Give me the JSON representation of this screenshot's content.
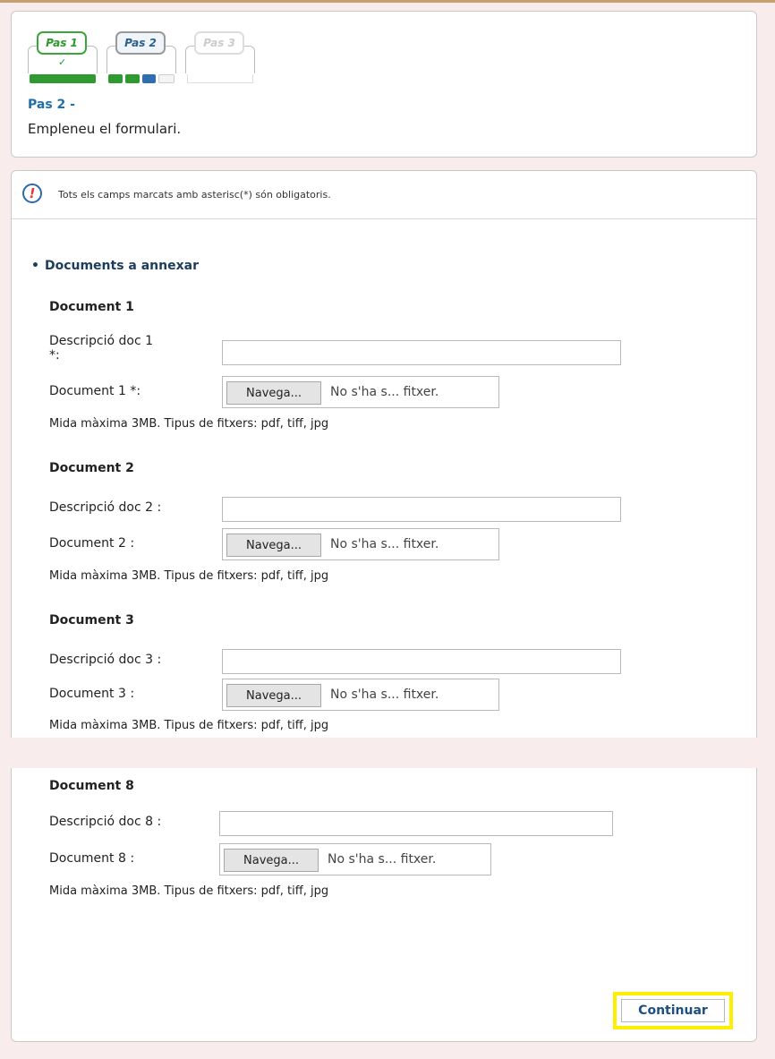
{
  "steps": [
    {
      "label": "Pas 1",
      "check": "✓"
    },
    {
      "label": "Pas 2"
    },
    {
      "label": "Pas 3"
    }
  ],
  "step_heading": "Pas 2 -",
  "step_description": "Empleneu el formulari.",
  "notice": {
    "icon": "exclamation-icon",
    "text": "Tots els camps marcats amb asterisc(*) són obligatoris."
  },
  "section_title": "Documents a annexar",
  "documents": [
    {
      "title": "Document 1",
      "desc_label_line1": "Descripció doc 1",
      "desc_label_line2": "*:",
      "desc_value": "",
      "file_label": "Document 1 *:",
      "browse_label": "Navega...",
      "file_status": "No s'ha s... fitxer.",
      "hint": "Mida màxima 3MB. Tipus de fitxers: pdf, tiff, jpg"
    },
    {
      "title": "Document 2",
      "desc_label": "Descripció doc 2 :",
      "desc_value": "",
      "file_label": "Document 2 :",
      "browse_label": "Navega...",
      "file_status": "No s'ha s... fitxer.",
      "hint": "Mida màxima 3MB. Tipus de fitxers: pdf, tiff, jpg"
    },
    {
      "title": "Document 3",
      "desc_label": "Descripció doc 3 :",
      "desc_value": "",
      "file_label": "Document 3 :",
      "browse_label": "Navega...",
      "file_status": "No s'ha s... fitxer.",
      "hint": "Mida màxima 3MB. Tipus de fitxers: pdf, tiff, jpg"
    },
    {
      "title": "Document 8",
      "desc_label": "Descripció doc 8 :",
      "desc_value": "",
      "file_label": "Document 8 :",
      "browse_label": "Navega...",
      "file_status": "No s'ha s... fitxer.",
      "hint": "Mida màxima 3MB. Tipus de fitxers: pdf, tiff, jpg"
    }
  ],
  "continue_label": "Continuar",
  "colors": {
    "step_done": "#2f9a2f",
    "step_current": "#2f6fb0",
    "heading_blue": "#1f6fa8",
    "highlight": "#ffee00",
    "page_bg": "#f8ecec"
  }
}
